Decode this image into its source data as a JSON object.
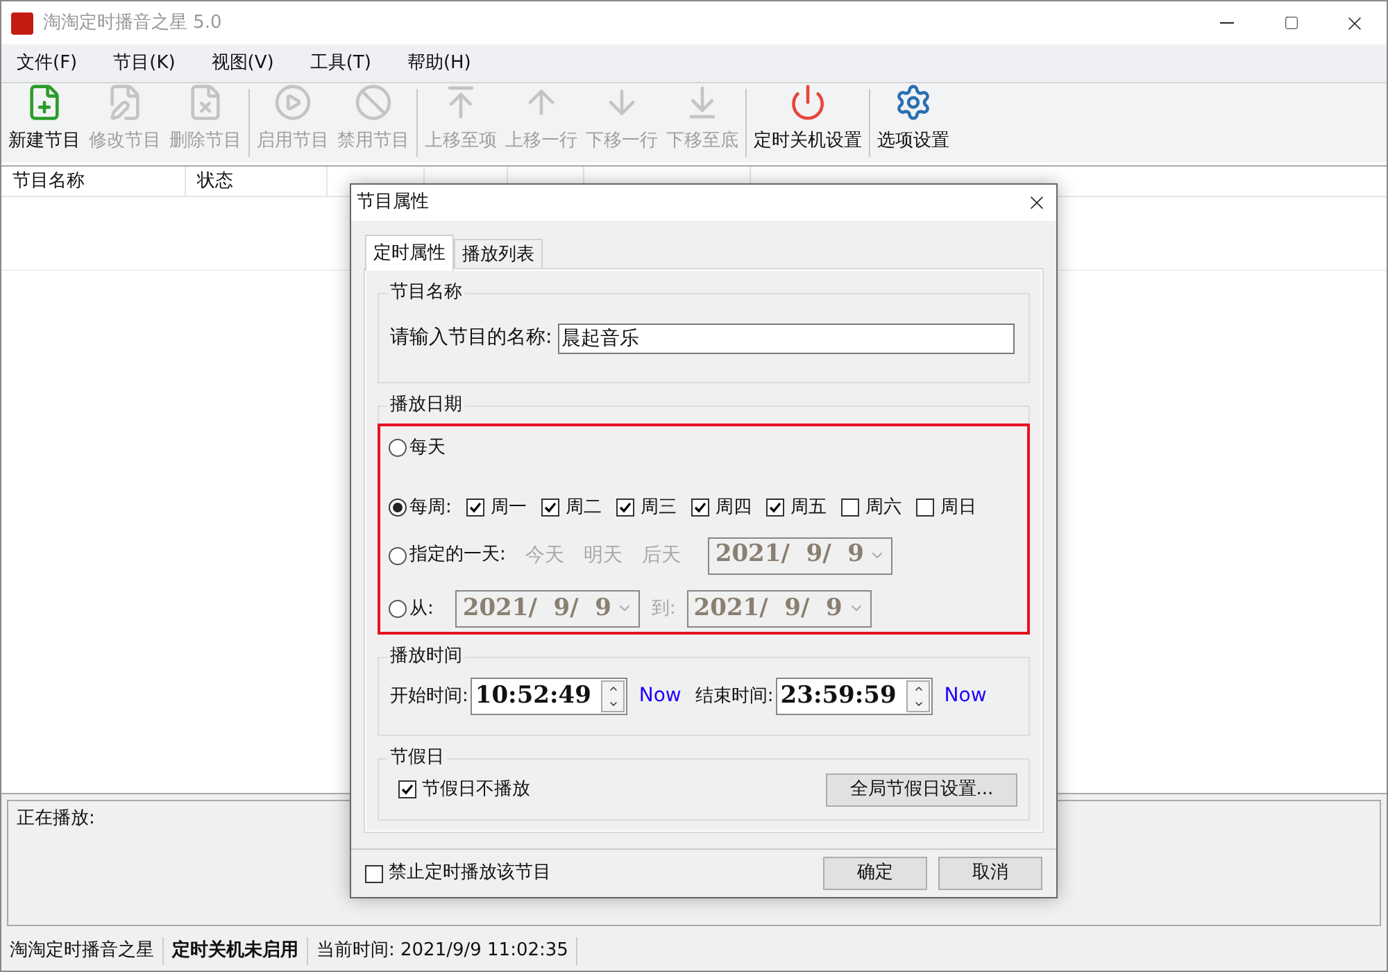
{
  "window": {
    "title": "淘淘定时播音之星 5.0"
  },
  "menu": [
    "文件(F)",
    "节目(K)",
    "视图(V)",
    "工具(T)",
    "帮助(H)"
  ],
  "toolbar": [
    {
      "kind": "new",
      "label": "新建节目",
      "disabled": false
    },
    {
      "kind": "edit",
      "label": "修改节目",
      "disabled": true
    },
    {
      "kind": "delete",
      "label": "删除节目",
      "disabled": true
    },
    {
      "kind": "sep"
    },
    {
      "kind": "play",
      "label": "启用节目",
      "disabled": true
    },
    {
      "kind": "ban",
      "label": "禁用节目",
      "disabled": true
    },
    {
      "kind": "sep"
    },
    {
      "kind": "top",
      "label": "上移至项",
      "disabled": true
    },
    {
      "kind": "up",
      "label": "上移一行",
      "disabled": true
    },
    {
      "kind": "down",
      "label": "下移一行",
      "disabled": true
    },
    {
      "kind": "bottom",
      "label": "下移至底",
      "disabled": true
    },
    {
      "kind": "sep"
    },
    {
      "kind": "power",
      "label": "定时关机设置",
      "disabled": false
    },
    {
      "kind": "sep"
    },
    {
      "kind": "settings",
      "label": "选项设置",
      "disabled": false
    }
  ],
  "table": {
    "columns": [
      "节目名称",
      "状态"
    ]
  },
  "playing_panel": {
    "label": "正在播放:"
  },
  "status_bar": [
    {
      "text": "淘淘定时播音之星",
      "bold": false
    },
    {
      "text": "定时关机未启用",
      "bold": true
    },
    {
      "text": "当前时间:  2021/9/9 11:02:35",
      "bold": false
    }
  ],
  "dialog": {
    "title": "节目属性",
    "tabs": [
      {
        "label": "定时属性",
        "selected": true
      },
      {
        "label": "播放列表",
        "selected": false
      }
    ],
    "name_group": {
      "title": "节目名称",
      "label": "请输入节目的名称:",
      "value": "晨起音乐"
    },
    "date_group": {
      "title": "播放日期",
      "daily": {
        "label": "每天",
        "selected": false
      },
      "weekly": {
        "label": "每周:",
        "selected": true,
        "days": [
          {
            "label": "周一",
            "checked": true
          },
          {
            "label": "周二",
            "checked": true
          },
          {
            "label": "周三",
            "checked": true
          },
          {
            "label": "周四",
            "checked": true
          },
          {
            "label": "周五",
            "checked": true
          },
          {
            "label": "周六",
            "checked": false
          },
          {
            "label": "周日",
            "checked": false
          }
        ]
      },
      "single": {
        "label": "指定的一天:",
        "selected": false,
        "quick": [
          "今天",
          "明天",
          "后天"
        ],
        "date": "2021/  9/  9"
      },
      "range": {
        "label": "从:",
        "selected": false,
        "from": "2021/  9/  9",
        "to_label": "到:",
        "to": "2021/  9/  9"
      }
    },
    "time_group": {
      "title": "播放时间",
      "start_label": "开始时间:",
      "start": "10:52:49",
      "start_now": "Now",
      "end_label": "结束时间:",
      "end": "23:59:59",
      "end_now": "Now"
    },
    "holiday_group": {
      "title": "节假日",
      "skip": {
        "label": "节假日不播放",
        "checked": true
      },
      "button": "全局节假日设置..."
    },
    "disable": {
      "label": "禁止定时播放该节目",
      "checked": false
    },
    "buttons": [
      "确定",
      "取消"
    ]
  }
}
